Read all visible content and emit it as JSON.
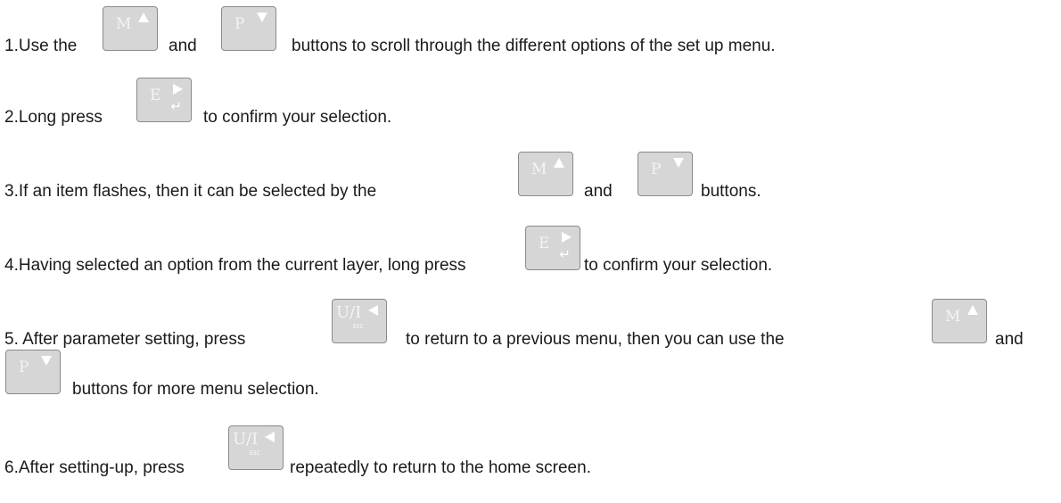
{
  "steps": [
    {
      "parts": [
        "1.Use the",
        "and",
        "buttons to scroll through the different options of the set up menu."
      ]
    },
    {
      "parts": [
        "2.Long press",
        "to confirm your selection."
      ]
    },
    {
      "parts": [
        "3.If an item flashes, then it can be selected by the",
        "and",
        "buttons."
      ]
    },
    {
      "parts": [
        "4.Having selected an option from the current layer, long press",
        "to confirm your selection."
      ]
    },
    {
      "parts": [
        "5. After parameter setting, press",
        "to return to a previous menu,   then you can use the",
        "and"
      ]
    },
    {
      "parts": [
        "buttons for more menu selection."
      ]
    },
    {
      "parts": [
        "6.After setting-up, press",
        "repeatedly to return to the home screen."
      ]
    }
  ],
  "buttons": {
    "m": {
      "letter": "M",
      "icon": "up-triangle-icon"
    },
    "p": {
      "letter": "P",
      "icon": "down-triangle-icon"
    },
    "e": {
      "letter": "E",
      "icon": "right-triangle-icon",
      "sub": "↵"
    },
    "ui": {
      "letter": "U/I",
      "icon": "left-triangle-icon",
      "sub": "ESC"
    }
  }
}
